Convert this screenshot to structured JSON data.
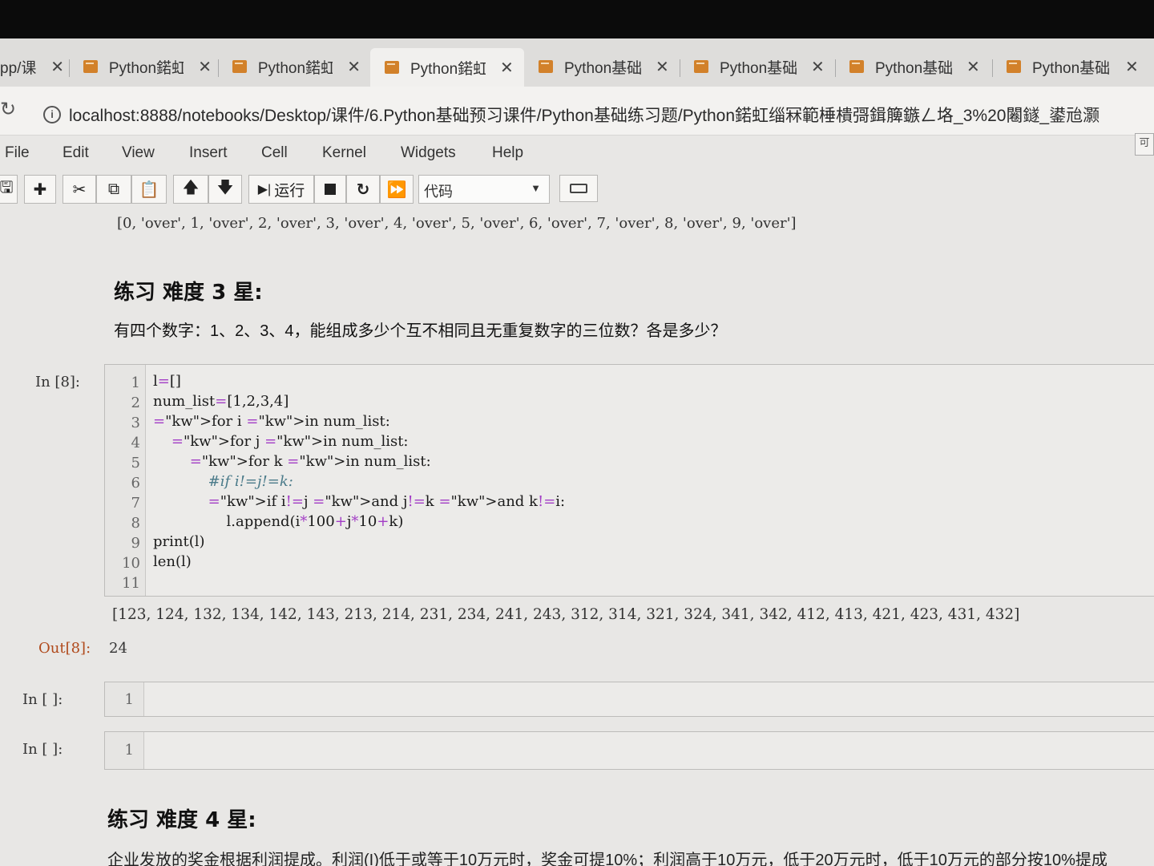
{
  "browser": {
    "tabs": [
      {
        "title": "pp/课"
      },
      {
        "title": "Python鍩虹"
      },
      {
        "title": "Python鍩虹"
      },
      {
        "title": "Python鍩虹"
      },
      {
        "title": "Python基础"
      },
      {
        "title": "Python基础"
      },
      {
        "title": "Python基础"
      },
      {
        "title": "Python基础"
      }
    ],
    "close_glyph": "✕",
    "url": "localhost:8888/notebooks/Desktop/课件/6.Python基础预习课件/Python基础练习题/Python鍩虹缁冧範棰樻彁鍓簲鏃ㄥ垎_3%20闂鐩_鍙兘灏"
  },
  "menu": [
    "File",
    "Edit",
    "View",
    "Insert",
    "Cell",
    "Kernel",
    "Widgets",
    "Help"
  ],
  "toolbar": {
    "run_label": "运行",
    "cell_type": "代码",
    "icons": [
      "save-icon",
      "plus-icon",
      "cut-icon",
      "copy-icon",
      "paste-icon",
      "arrow-up-icon",
      "arrow-down-icon",
      "run-icon",
      "stop-icon",
      "restart-icon",
      "fast-forward-icon",
      "keyboard-icon"
    ]
  },
  "notebook": {
    "prev_output": "[0, 'over', 1, 'over', 2, 'over', 3, 'over', 4, 'over', 5, 'over', 6, 'over', 7, 'over', 8, 'over', 9, 'over']",
    "md1_heading": "练习 难度 3 星:",
    "md1_text": "有四个数字：1、2、3、4，能组成多少个互不相同且无重复数字的三位数？各是多少？",
    "cell8": {
      "prompt": "In  [8]:",
      "lines": [
        "l=[]",
        "num_list=[1,2,3,4]",
        "for i in num_list:",
        "    for j in num_list:",
        "        for k in num_list:",
        "            #if i!=j!=k:",
        "            if i!=j and j!=k and k!=i:",
        "                l.append(i*100+j*10+k)",
        "print(l)",
        "len(l)",
        ""
      ],
      "line_numbers": [
        "1",
        "2",
        "3",
        "4",
        "5",
        "6",
        "7",
        "8",
        "9",
        "10",
        "11"
      ],
      "stdout": "[123, 124, 132, 134, 142, 143, 213, 214, 231, 234, 241, 243, 312, 314, 321, 324, 341, 342, 412, 413, 421, 423, 431, 432]",
      "out_prompt": "Out[8]:",
      "out_value": "24"
    },
    "empty_cells": [
      {
        "prompt": "In  [ ]:",
        "line": "1"
      },
      {
        "prompt": "In  [ ]:",
        "line": "1"
      }
    ],
    "md2_heading": "练习 难度 4 星:",
    "md2_text": "企业发放的奖金根据利润提成。利润(I)低于或等于10万元时，奖金可提10%；利润高于10万元，低于20万元时，低于10万元的部分按10%提成"
  }
}
